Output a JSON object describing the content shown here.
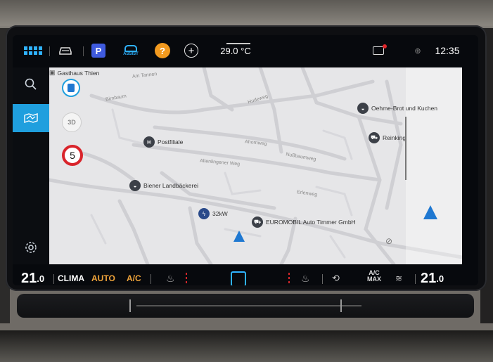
{
  "statusbar": {
    "outside_temp": "29.0 °C",
    "time": "12:35",
    "park_label": "P",
    "assist_label": "ASSIST",
    "help_label": "?",
    "add_label": "+"
  },
  "map": {
    "pois": [
      {
        "label": "Gasthaus Thien"
      },
      {
        "label": "Postfiliale"
      },
      {
        "label": "Biener Landbäckerei"
      },
      {
        "label": "32kW"
      },
      {
        "label": "EUROMOBIL Auto Timmer GmbH"
      },
      {
        "label": "Oehme-Brot und Kuchen"
      },
      {
        "label": "Reinking"
      }
    ],
    "streets": [
      {
        "label": "Hudeweg"
      },
      {
        "label": "Ahornweg"
      },
      {
        "label": "Nußbaumweg"
      },
      {
        "label": "Altenlingener Weg"
      },
      {
        "label": "Erlenweg"
      },
      {
        "label": "Birnbaum"
      },
      {
        "label": "Am Tannen"
      }
    ],
    "speed_limit": "5",
    "view_3d_label": "3D"
  },
  "climate": {
    "temp_left_int": "21",
    "temp_left_dec": ".0",
    "clima_label": "CLIMA",
    "auto_label": "AUTO",
    "ac_label": "A/C",
    "acmax_top": "A/C",
    "acmax_bottom": "MAX",
    "temp_right_int": "21",
    "temp_right_dec": ".0"
  },
  "colors": {
    "accent": "#1f9fde",
    "climate_active": "#f0a43a",
    "speed_limit_ring": "#d9242b",
    "notification_dot": "#e0262a",
    "help_badge": "#f29a1f",
    "park_badge": "#3f5bdf"
  },
  "icons": [
    "apps-grid-icon",
    "car-icon",
    "parking-icon",
    "assist-icon",
    "help-icon",
    "add-icon",
    "message-icon",
    "globe-icon",
    "search-icon",
    "map-layers-icon",
    "settings-icon",
    "fuel-station-icon",
    "mail-icon",
    "bakery-icon",
    "charging-icon",
    "car-dealer-icon",
    "heated-seat-icon",
    "recirculation-icon",
    "defrost-icon",
    "navigation-arrow-icon"
  ]
}
